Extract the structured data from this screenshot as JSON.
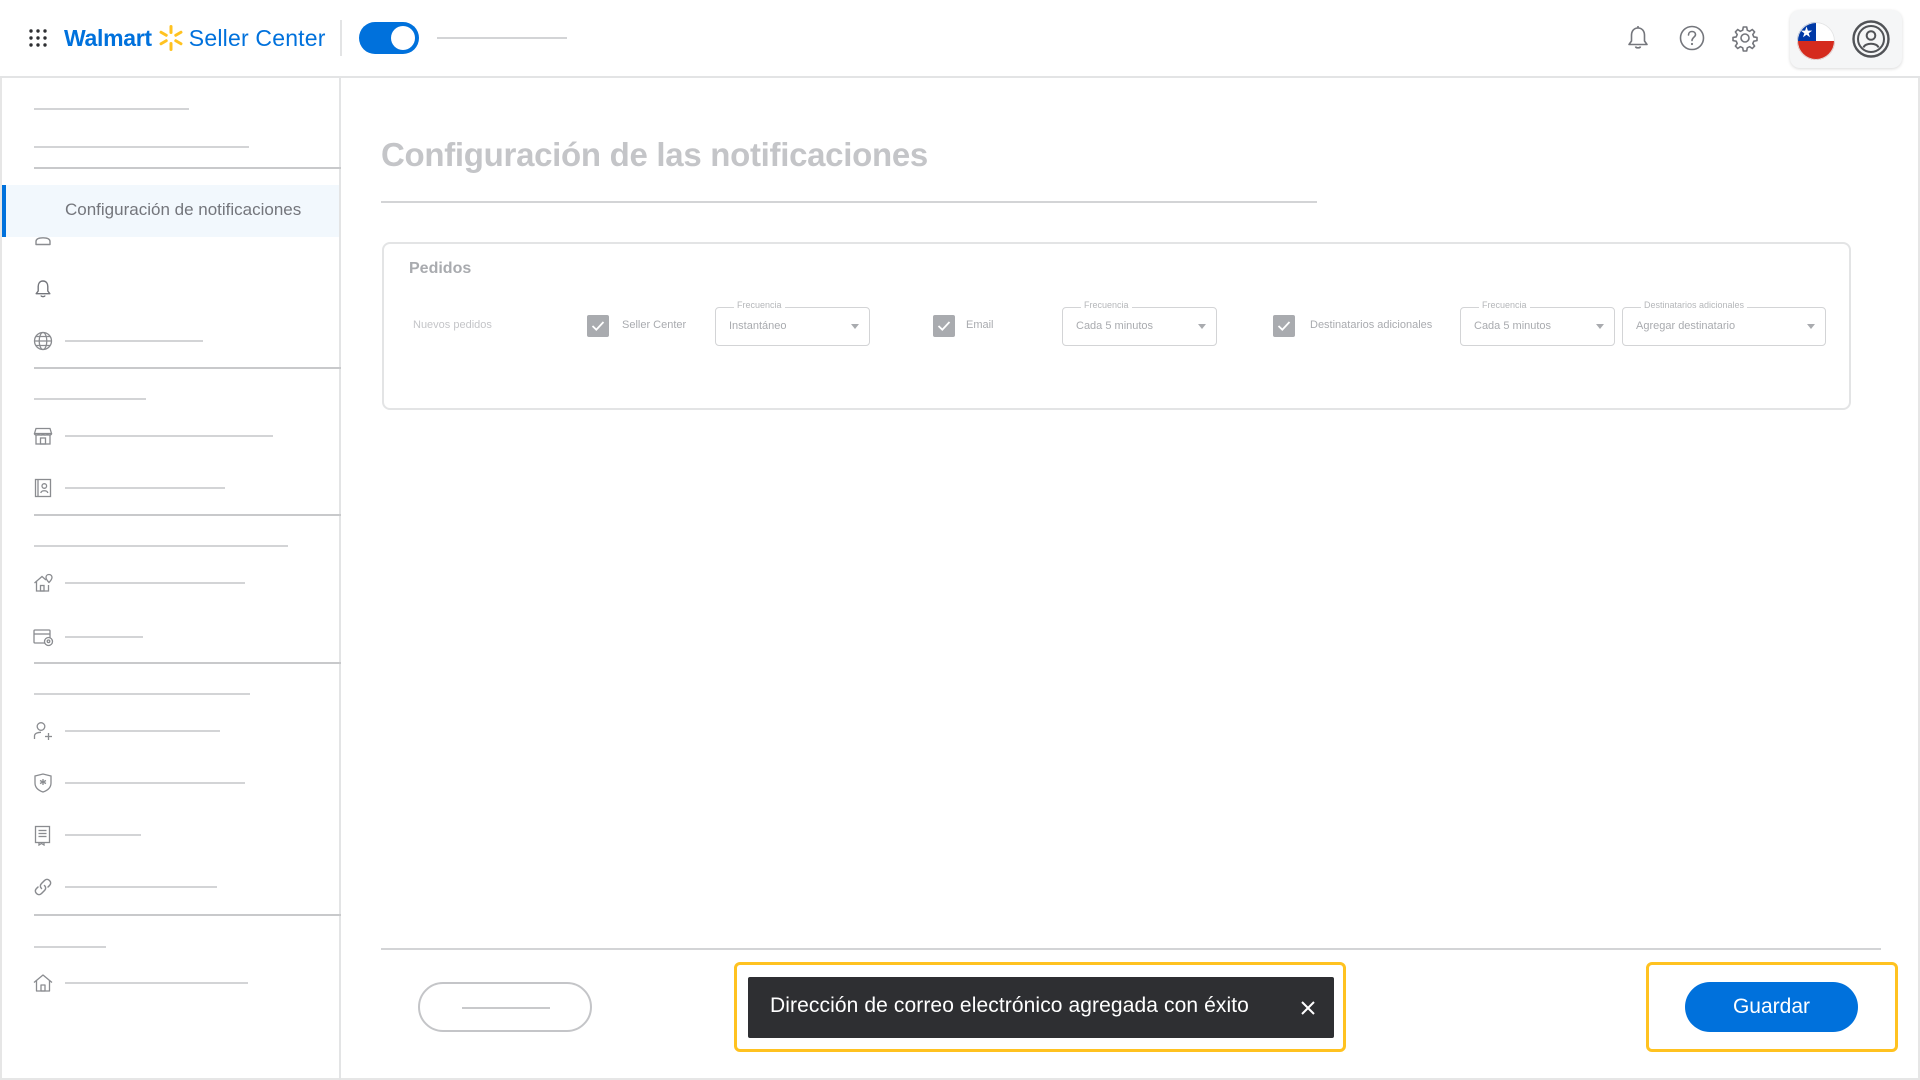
{
  "header": {
    "brand": "Walmart",
    "product": "Seller Center",
    "icons": [
      "apps-grid-icon",
      "spark-icon",
      "bell-icon",
      "help-icon",
      "gear-icon",
      "chile-flag-icon",
      "user-avatar-icon"
    ]
  },
  "sidebar": {
    "active_item_label": "Configuración de notificaciones",
    "icons": [
      "user-icon",
      "bell-icon",
      "globe-icon",
      "store-icon",
      "badge-icon",
      "home-location-icon",
      "card-location-icon",
      "add-user-icon",
      "shield-icon",
      "document-icon",
      "link-icon",
      "home-icon"
    ]
  },
  "main": {
    "title": "Configuración de las notificaciones",
    "card": {
      "title": "Pedidos",
      "row": {
        "label": "Nuevos pedidos",
        "seller_center": {
          "label": "Seller Center",
          "checked": true
        },
        "seller_center_frequency": {
          "field_label": "Frecuencia",
          "value": "Instantáneo"
        },
        "email": {
          "label": "Email",
          "checked": true
        },
        "email_frequency": {
          "field_label": "Frecuencia",
          "value": "Cada 5 minutos"
        },
        "additional": {
          "label": "Destinatarios adicionales",
          "checked": true
        },
        "additional_frequency": {
          "field_label": "Frecuencia",
          "value": "Cada 5 minutos"
        },
        "additional_recipients": {
          "field_label": "Destinatarios adicionales",
          "value": "Agregar destinatario"
        }
      }
    }
  },
  "toast": {
    "message": "Dirección de correo electrónico agregada con éxito"
  },
  "footer": {
    "save_label": "Guardar"
  },
  "colors": {
    "accent": "#0071dc",
    "spark": "#ffc220",
    "highlight": "#ffc220",
    "toast_bg": "#2e2f32"
  }
}
